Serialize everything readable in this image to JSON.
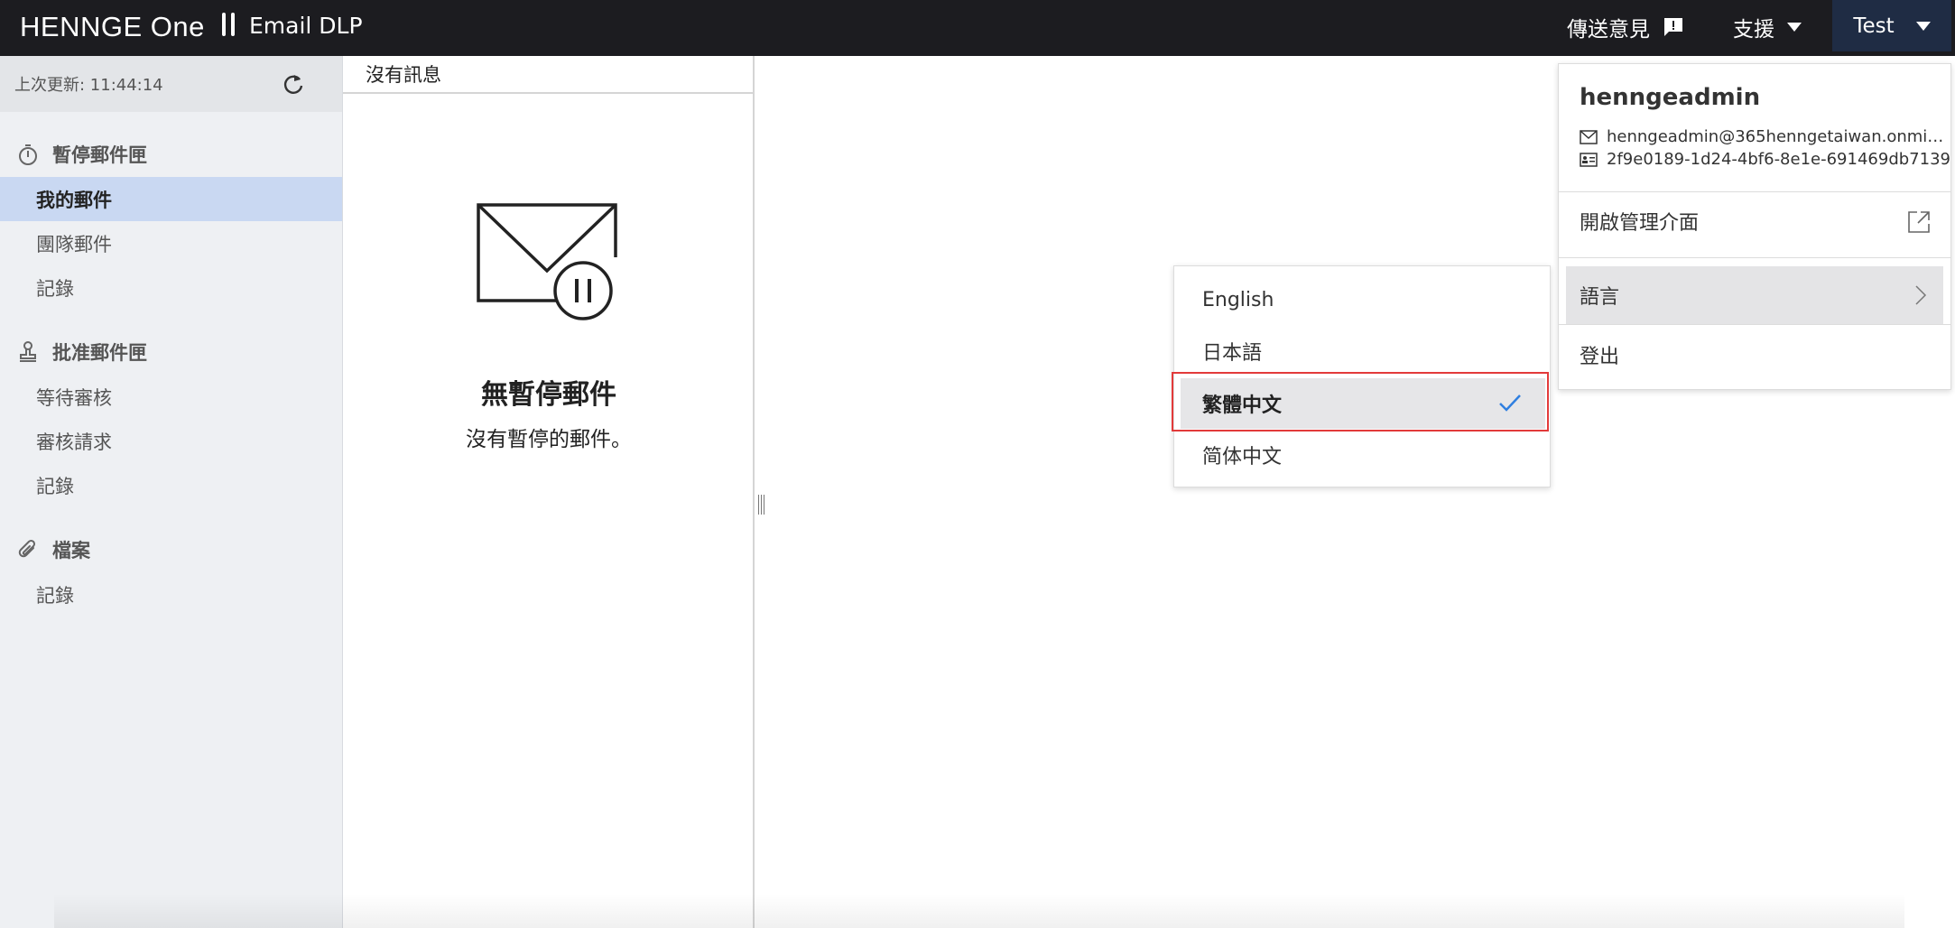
{
  "header": {
    "brand": "HENNGE One",
    "product": "Email DLP",
    "feedback_label": "傳送意見",
    "support_label": "支援",
    "user_button_label": "Test"
  },
  "sidebar": {
    "last_updated": "上次更新: 11:44:14",
    "sections": [
      {
        "title": "暫停郵件匣",
        "icon": "timer-icon",
        "items": [
          "我的郵件",
          "團隊郵件",
          "記錄"
        ]
      },
      {
        "title": "批准郵件匣",
        "icon": "stamp-icon",
        "items": [
          "等待審核",
          "審核請求",
          "記錄"
        ]
      },
      {
        "title": "檔案",
        "icon": "paperclip-icon",
        "items": [
          "記錄"
        ]
      }
    ],
    "active_item": "我的郵件"
  },
  "list_pane": {
    "header": "沒有訊息",
    "empty_title": "無暫停郵件",
    "empty_subtitle": "沒有暫停的郵件。"
  },
  "language_menu": {
    "options": [
      "English",
      "日本語",
      "繁體中文",
      "简体中文"
    ],
    "selected": "繁體中文"
  },
  "user_menu": {
    "username": "henngeadmin",
    "email": "henngeadmin@365henngetaiwan.onmi…",
    "id": "2f9e0189-1d24-4bf6-8e1e-691469db7139",
    "open_admin_label": "開啟管理介面",
    "language_label": "語言",
    "logout_label": "登出"
  },
  "colors": {
    "topbar": "#1c1c20",
    "user_button": "#1f2c44",
    "active_nav": "#c9d8f2",
    "check": "#2f7fe0",
    "highlight": "#e23a3a"
  }
}
